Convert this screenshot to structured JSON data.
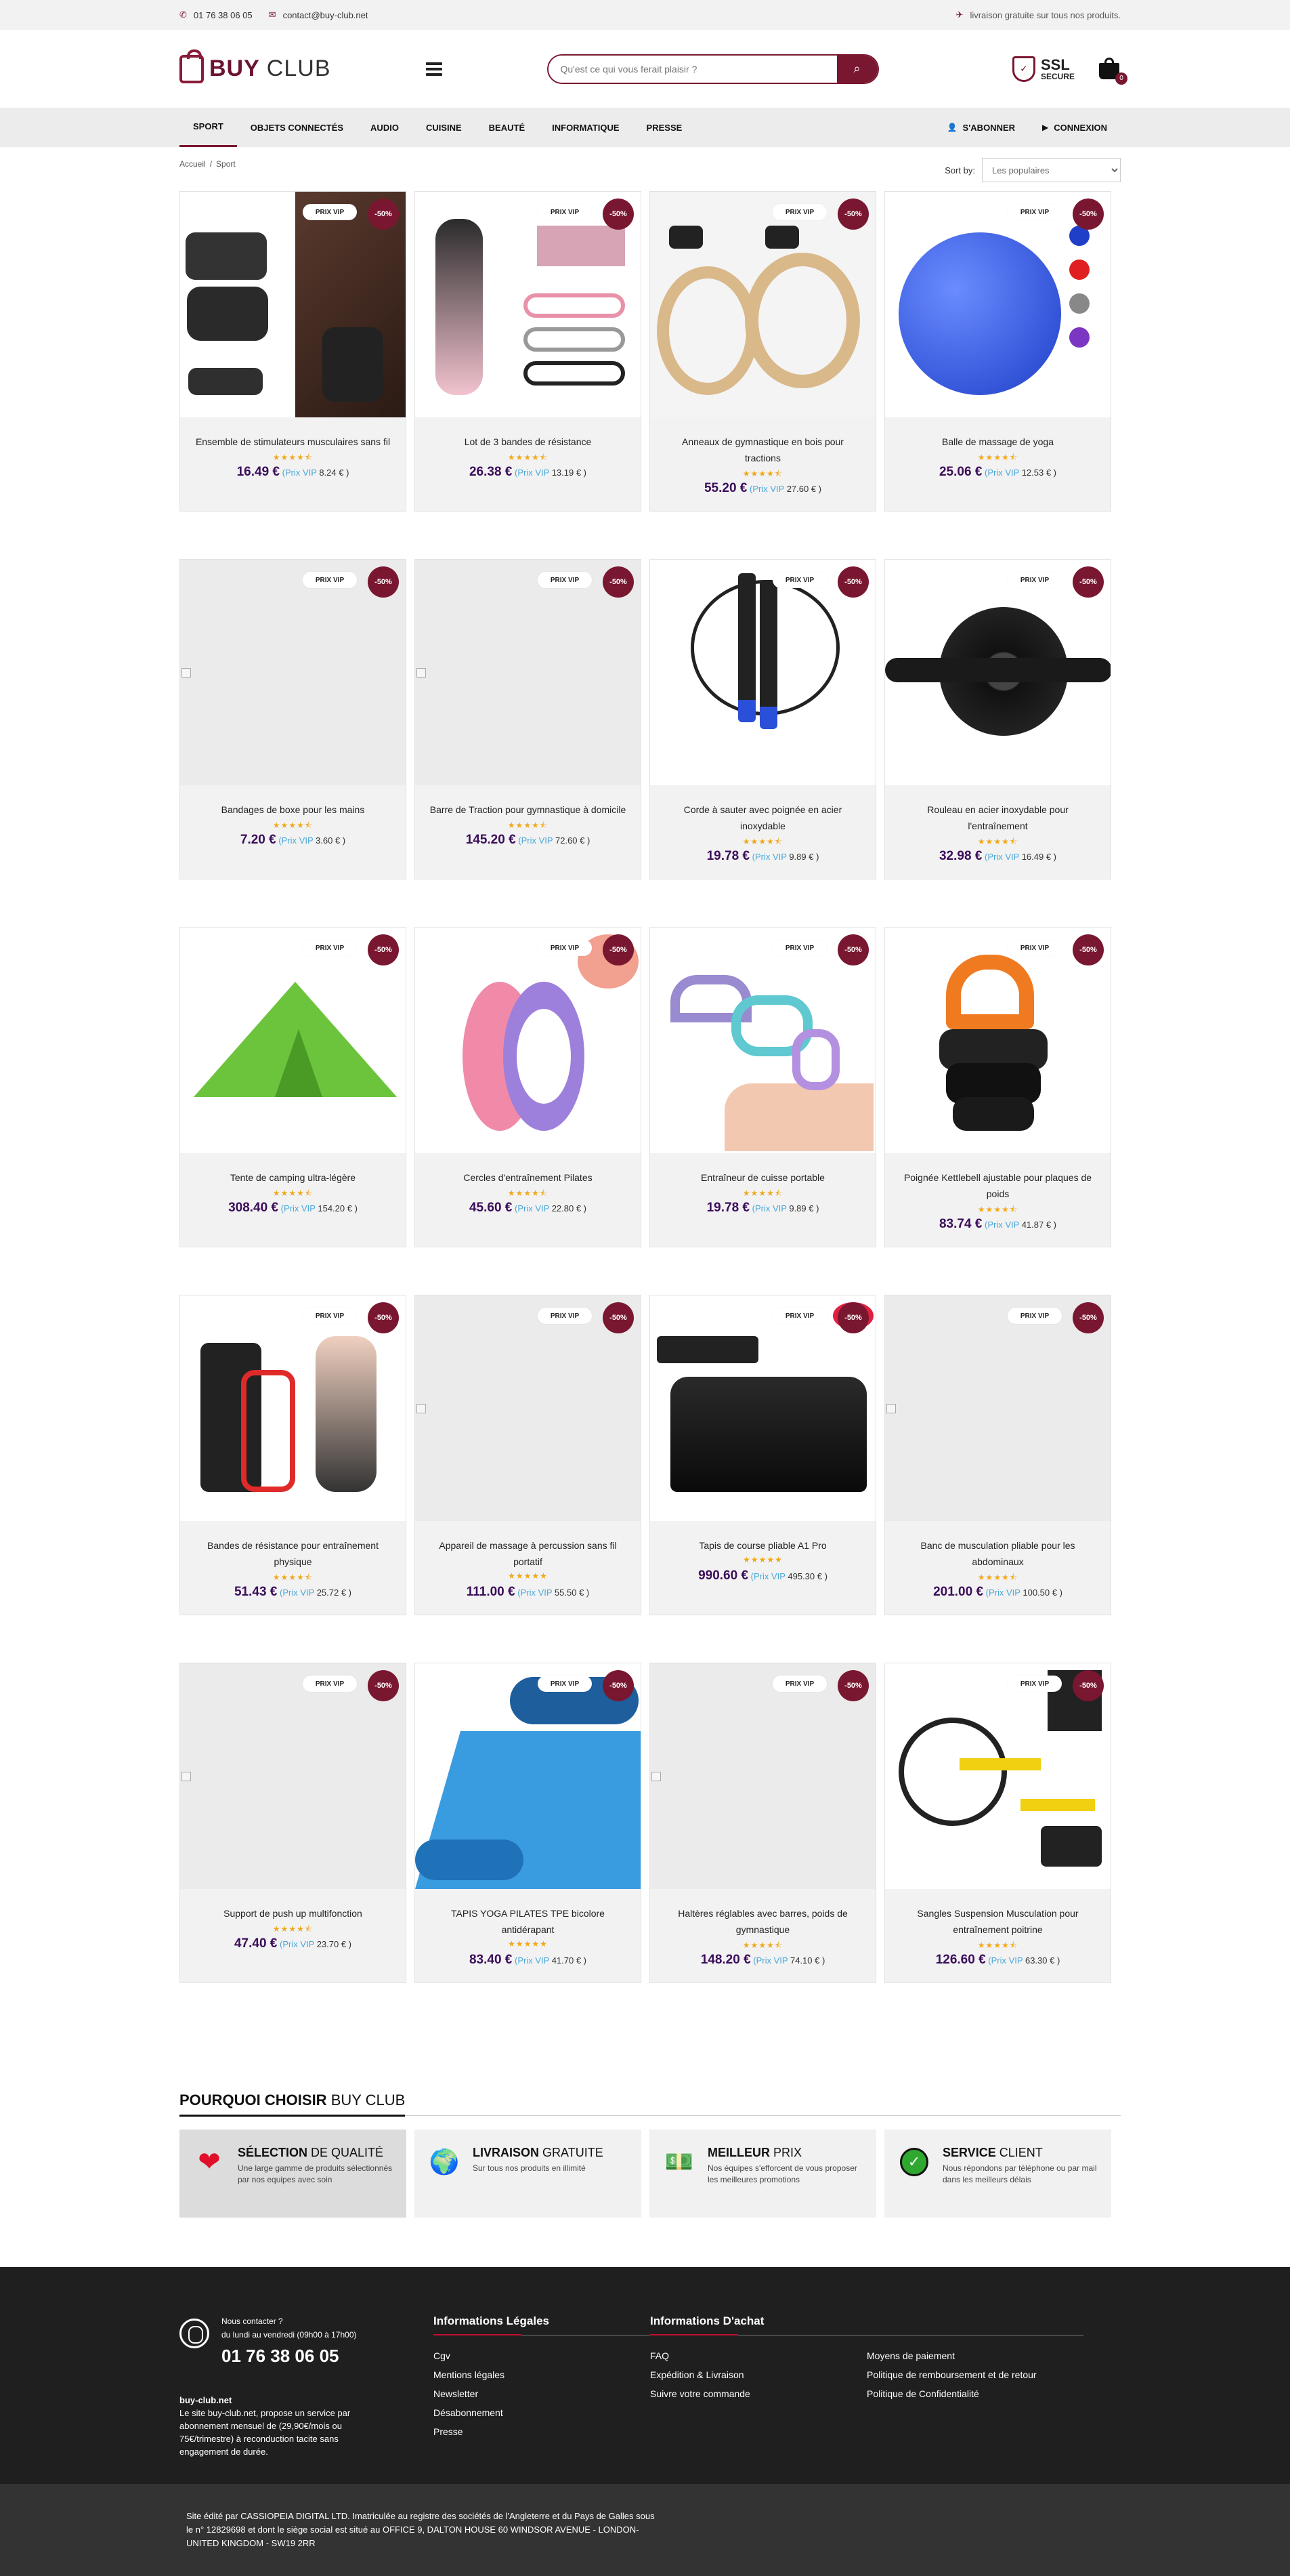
{
  "topbar": {
    "phone": "01 76 38 06 05",
    "email": "contact@buy-club.net",
    "shipping": "livraison gratuite sur tous nos produits."
  },
  "header": {
    "logo_buy": "BUY",
    "logo_club": "CLUB",
    "search_placeholder": "Qu'est ce qui vous ferait plaisir ?",
    "ssl_title": "SSL",
    "ssl_sub": "SECURE",
    "cart_count": "0"
  },
  "nav": {
    "items": [
      "SPORT",
      "OBJETS CONNECTÉS",
      "AUDIO",
      "CUISINE",
      "BEAUTÉ",
      "INFORMATIQUE",
      "PRESSE"
    ],
    "subscribe": "S'ABONNER",
    "login": "CONNEXION"
  },
  "breadcrumb": {
    "home": "Accueil",
    "current": "Sport"
  },
  "sort": {
    "label": "Sort by:",
    "selected": "Les populaires"
  },
  "badges": {
    "vip": "PRIX VIP",
    "discount": "-50%",
    "vip_label": "Prix VIP"
  },
  "products": [
    {
      "name": "Ensemble de stimulateurs musculaires sans fil",
      "price": "16.49 €",
      "vip": "8.24 €",
      "stars": "★★★★⯪"
    },
    {
      "name": "Lot de 3 bandes de résistance",
      "price": "26.38 €",
      "vip": "13.19 €",
      "stars": "★★★★⯪"
    },
    {
      "name": "Anneaux de gymnastique en bois pour tractions",
      "price": "55.20 €",
      "vip": "27.60 €",
      "stars": "★★★★⯪"
    },
    {
      "name": "Balle de massage de yoga",
      "price": "25.06 €",
      "vip": "12.53 €",
      "stars": "★★★★⯪"
    },
    {
      "name": "Bandages de boxe pour les mains",
      "price": "7.20 €",
      "vip": "3.60 €",
      "stars": "★★★★⯪"
    },
    {
      "name": "Barre de Traction pour gymnastique à domicile",
      "price": "145.20 €",
      "vip": "72.60 €",
      "stars": "★★★★⯪"
    },
    {
      "name": "Corde à sauter avec poignée en acier inoxydable",
      "price": "19.78 €",
      "vip": "9.89 €",
      "stars": "★★★★⯪"
    },
    {
      "name": "Rouleau en acier inoxydable pour l'entraînement",
      "price": "32.98 €",
      "vip": "16.49 €",
      "stars": "★★★★⯪"
    },
    {
      "name": "Tente de camping ultra-légère",
      "price": "308.40 €",
      "vip": "154.20 €",
      "stars": "★★★★⯪"
    },
    {
      "name": "Cercles d'entraînement Pilates",
      "price": "45.60 €",
      "vip": "22.80 €",
      "stars": "★★★★⯪"
    },
    {
      "name": "Entraîneur de cuisse portable",
      "price": "19.78 €",
      "vip": "9.89 €",
      "stars": "★★★★⯪"
    },
    {
      "name": "Poignée Kettlebell ajustable pour plaques de poids",
      "price": "83.74 €",
      "vip": "41.87 €",
      "stars": "★★★★⯪"
    },
    {
      "name": "Bandes de résistance pour entraînement physique",
      "price": "51.43 €",
      "vip": "25.72 €",
      "stars": "★★★★⯪"
    },
    {
      "name": "Appareil de massage à percussion sans fil portatif",
      "price": "111.00 €",
      "vip": "55.50 €",
      "stars": "★★★★★"
    },
    {
      "name": "Tapis de course pliable A1 Pro",
      "price": "990.60 €",
      "vip": "495.30 €",
      "stars": "★★★★★"
    },
    {
      "name": "Banc de musculation pliable pour les abdominaux",
      "price": "201.00 €",
      "vip": "100.50 €",
      "stars": "★★★★⯪"
    },
    {
      "name": "Support de push up multifonction",
      "price": "47.40 €",
      "vip": "23.70 €",
      "stars": "★★★★⯪"
    },
    {
      "name": "TAPIS YOGA PILATES TPE bicolore antidérapant",
      "price": "83.40 €",
      "vip": "41.70 €",
      "stars": "★★★★★"
    },
    {
      "name": "Haltères réglables avec barres, poids de gymnastique",
      "price": "148.20 €",
      "vip": "74.10 €",
      "stars": "★★★★⯪"
    },
    {
      "name": "Sangles Suspension Musculation pour entraînement poitrine",
      "price": "126.60 €",
      "vip": "63.30 €",
      "stars": "★★★★⯪"
    }
  ],
  "why": {
    "title_bold": "POURQUOI CHOISIR",
    "title_light": "BUY CLUB",
    "features": [
      {
        "bold": "SÉLECTION",
        "light": "DE QUALITÉ",
        "desc": "Une large gamme de produits sélectionnés par nos equipes avec soin"
      },
      {
        "bold": "LIVRAISON",
        "light": "GRATUITE",
        "desc": "Sur tous nos produits en illimité"
      },
      {
        "bold": "MEILLEUR",
        "light": "PRIX",
        "desc": "Nos équipes s'efforcent de vous proposer les meilleures promotions"
      },
      {
        "bold": "SERVICE",
        "light": "CLIENT",
        "desc": "Nous répondons par téléphone ou par mail dans les meilleurs délais"
      }
    ]
  },
  "footer": {
    "contact_title": "Nous contacter ?",
    "contact_hours": "du lundi au vendredi (09h00 à 17h00)",
    "phone": "01 76 38 06 05",
    "site": "buy-club.net",
    "about": "Le site buy-club.net, propose un service par abonnement mensuel de (29,90€/mois ou 75€/trimestre) à reconduction tacite sans engagement de durée.",
    "legal_title": "Informations Légales",
    "legal": [
      "Cgv",
      "Mentions légales",
      "Newsletter",
      "Désabonnement",
      "Presse"
    ],
    "purchase_title": "Informations D'achat",
    "purchase_left": [
      "FAQ",
      "Expédition & Livraison",
      "Suivre votre commande"
    ],
    "purchase_right": [
      "Moyens de paiement",
      "Politique de remboursement et de retour",
      "Politique de Confidentialité"
    ],
    "company": "Site édité par CASSIOPEIA DIGITAL LTD. Imatriculée au registre des sociétés de l'Angleterre et du Pays de Galles sous le n° 12829698 et dont le siège social est situé au OFFICE 9, DALTON HOUSE 60 WINDSOR AVENUE - LONDON- UNITED KINGDOM - SW19 2RR"
  }
}
